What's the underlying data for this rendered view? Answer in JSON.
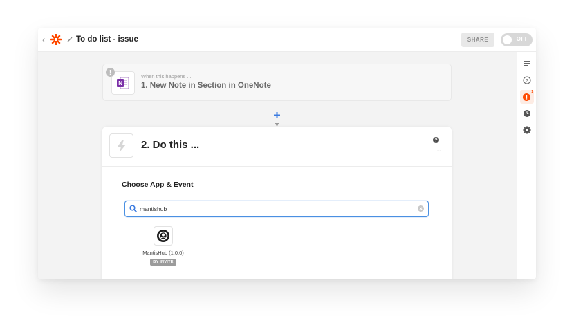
{
  "topbar": {
    "title": "To do list - issue",
    "share_label": "SHARE",
    "toggle_label": "OFF"
  },
  "steps": {
    "trigger": {
      "caption": "When this happens ...",
      "title": "1. New Note in Section in OneNote",
      "warning_mark": "!"
    },
    "action": {
      "title": "2. Do this ...",
      "more_label": "..."
    }
  },
  "choose": {
    "heading": "Choose App & Event",
    "search_value": "mantishub",
    "result": {
      "name": "MantisHub (1.0.0)",
      "badge": "BY INVITE"
    }
  },
  "sidebar": {
    "icons": [
      "outline-icon",
      "help-icon",
      "alert-icon",
      "history-icon",
      "settings-icon"
    ],
    "alert_count": "1"
  },
  "colors": {
    "brand_orange": "#ff4a00",
    "accent_blue": "#4a90e2",
    "onenote_purple": "#7b2fa8",
    "alert_orange": "#ff4a00"
  }
}
